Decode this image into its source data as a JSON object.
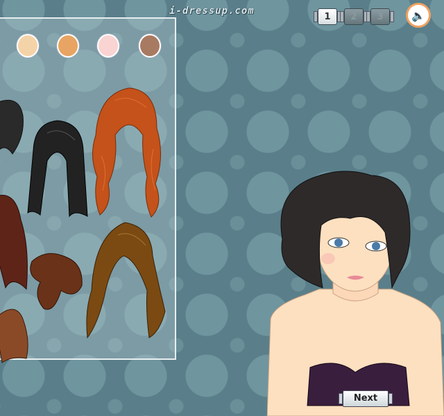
{
  "header": {
    "site_logo": "i-dressup.com"
  },
  "steps": [
    {
      "label": "1",
      "active": true
    },
    {
      "label": "2",
      "active": false
    },
    {
      "label": "3",
      "active": false
    }
  ],
  "sound": {
    "icon": "speaker-icon"
  },
  "swatches": [
    "#f5d3a8",
    "#e8a462",
    "#f9d4d2",
    "#a87a62"
  ],
  "hair_options": [
    {
      "name": "black-short-curly"
    },
    {
      "name": "black-long-straight"
    },
    {
      "name": "red-long-wavy"
    },
    {
      "name": "burgundy-long"
    },
    {
      "name": "brown-updo"
    },
    {
      "name": "brown-medium-wavy"
    },
    {
      "name": "auburn-bob"
    }
  ],
  "navigation": {
    "next_label": "Next"
  }
}
